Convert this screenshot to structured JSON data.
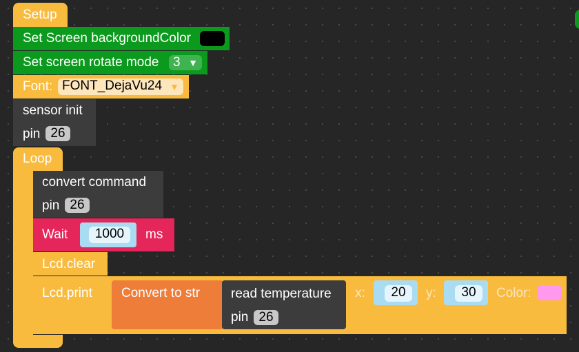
{
  "setup": {
    "label": "Setup",
    "bg_color_label": "Set Screen backgroundColor",
    "bg_color_value": "#000000",
    "rotate_label": "Set screen rotate mode",
    "rotate_value": "3",
    "font_label": "Font:",
    "font_value": "FONT_DejaVu24",
    "sensor_label": "sensor init",
    "sensor_pin_label": "pin",
    "sensor_pin_value": "26"
  },
  "loop": {
    "label": "Loop",
    "convert_label": "convert command",
    "convert_pin_label": "pin",
    "convert_pin_value": "26",
    "wait_label": "Wait",
    "wait_value": "1000",
    "wait_unit": "ms",
    "clear_label": "Lcd.clear",
    "print_label": "Lcd.print",
    "to_str_label": "Convert to str",
    "read_temp_label": "read temperature",
    "read_pin_label": "pin",
    "read_pin_value": "26",
    "x_label": "x:",
    "x_value": "20",
    "y_label": "y:",
    "y_value": "30",
    "color_label": "Color:",
    "color_value": "#ff99ee"
  },
  "colors": {
    "event": "#f8bb3d",
    "screen": "#0c9a1e",
    "sensor": "#3c3c3c",
    "timing": "#e5265b",
    "text": "#ee7d3a",
    "number_slot": "#a9dcf2"
  }
}
